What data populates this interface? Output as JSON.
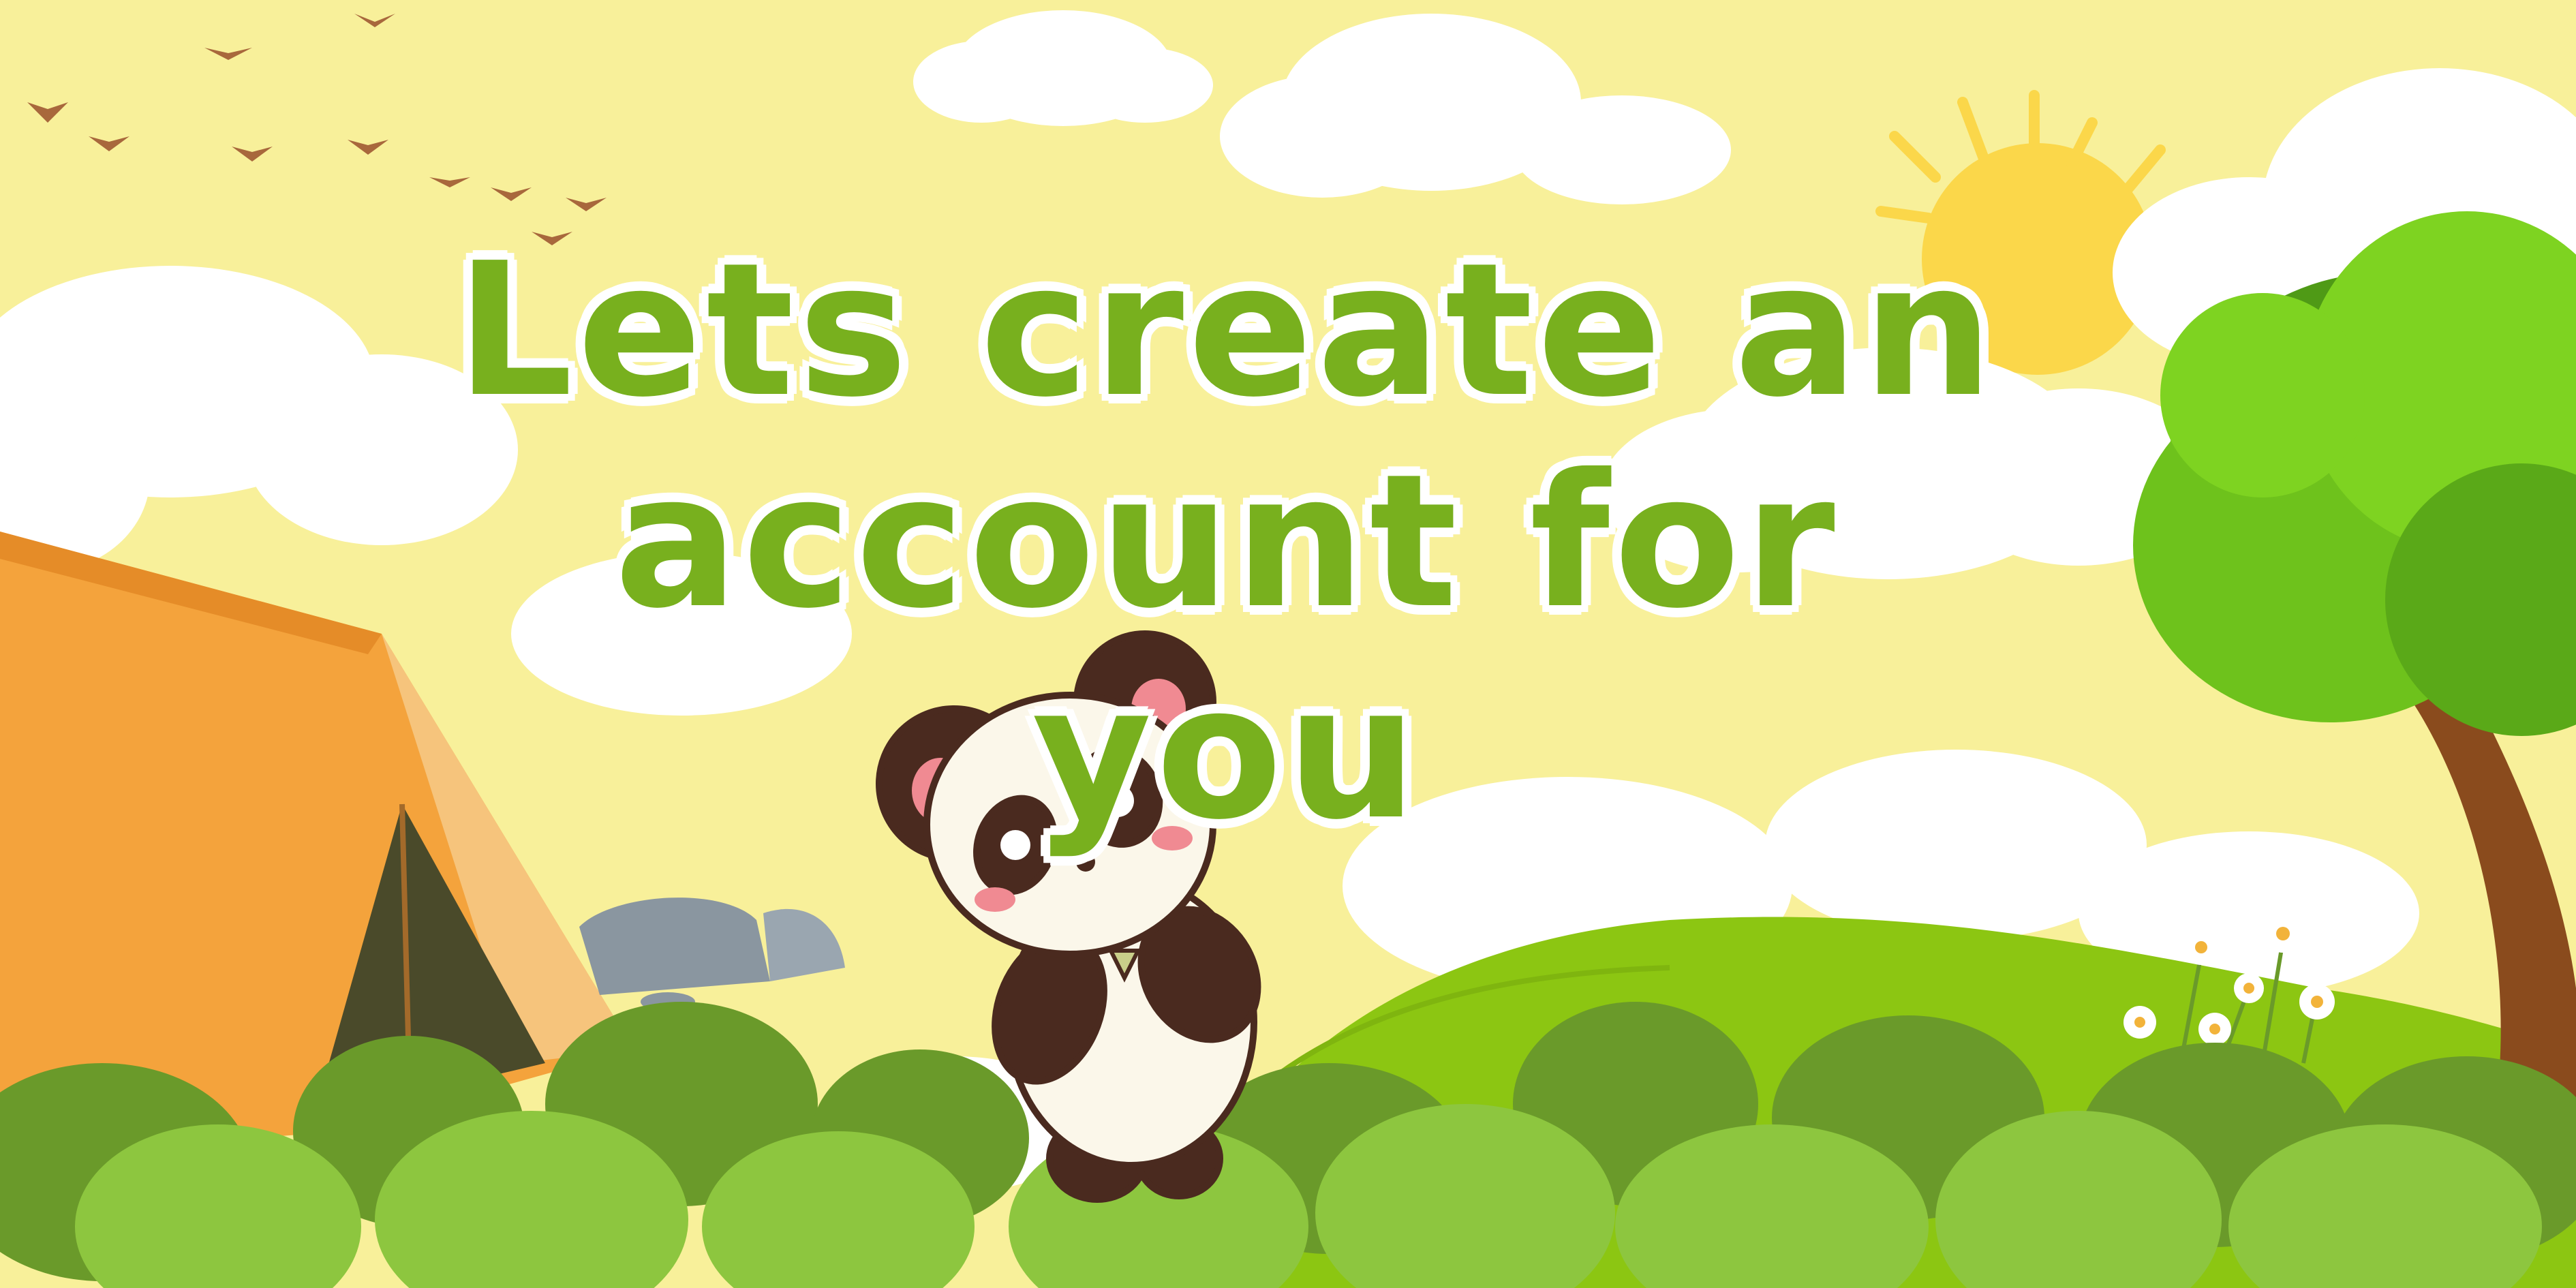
{
  "headline": {
    "line1": "Lets create an",
    "line2": "account for you"
  },
  "colors": {
    "sky": "#f8f09a",
    "headline": "#78b01e",
    "outline": "#ffffff",
    "tent": "#f4a33c",
    "hill": "#8cc612",
    "bush_dark": "#6a9a2a",
    "bush_light": "#8dc63f",
    "sun": "#fbd74a",
    "tree_leaves": "#6ec21c",
    "trunk": "#8a4b1d"
  },
  "icons": [
    "bird-icon",
    "sun-icon",
    "cloud-icon",
    "tent-icon",
    "rock-icon",
    "tree-icon",
    "flower-icon",
    "panda-icon",
    "bush-icon"
  ]
}
